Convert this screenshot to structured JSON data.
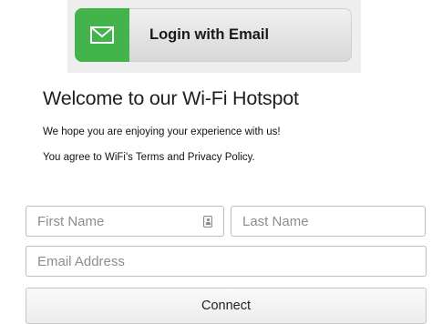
{
  "login": {
    "label": "Login with Email",
    "icon": "envelope-icon",
    "accent": "#43b34b"
  },
  "welcome": {
    "title": "Welcome to our Wi-Fi Hotspot",
    "line1": "We hope you are enjoying your experience with us!",
    "line2_prefix": "You agree to ",
    "line2_terms": "WiFi's Terms and Privacy Policy."
  },
  "form": {
    "first_name_placeholder": "First Name",
    "first_name_icon": "contact-card-icon",
    "last_name_placeholder": "Last Name",
    "email_placeholder": "Email Address",
    "connect_label": "Connect"
  }
}
